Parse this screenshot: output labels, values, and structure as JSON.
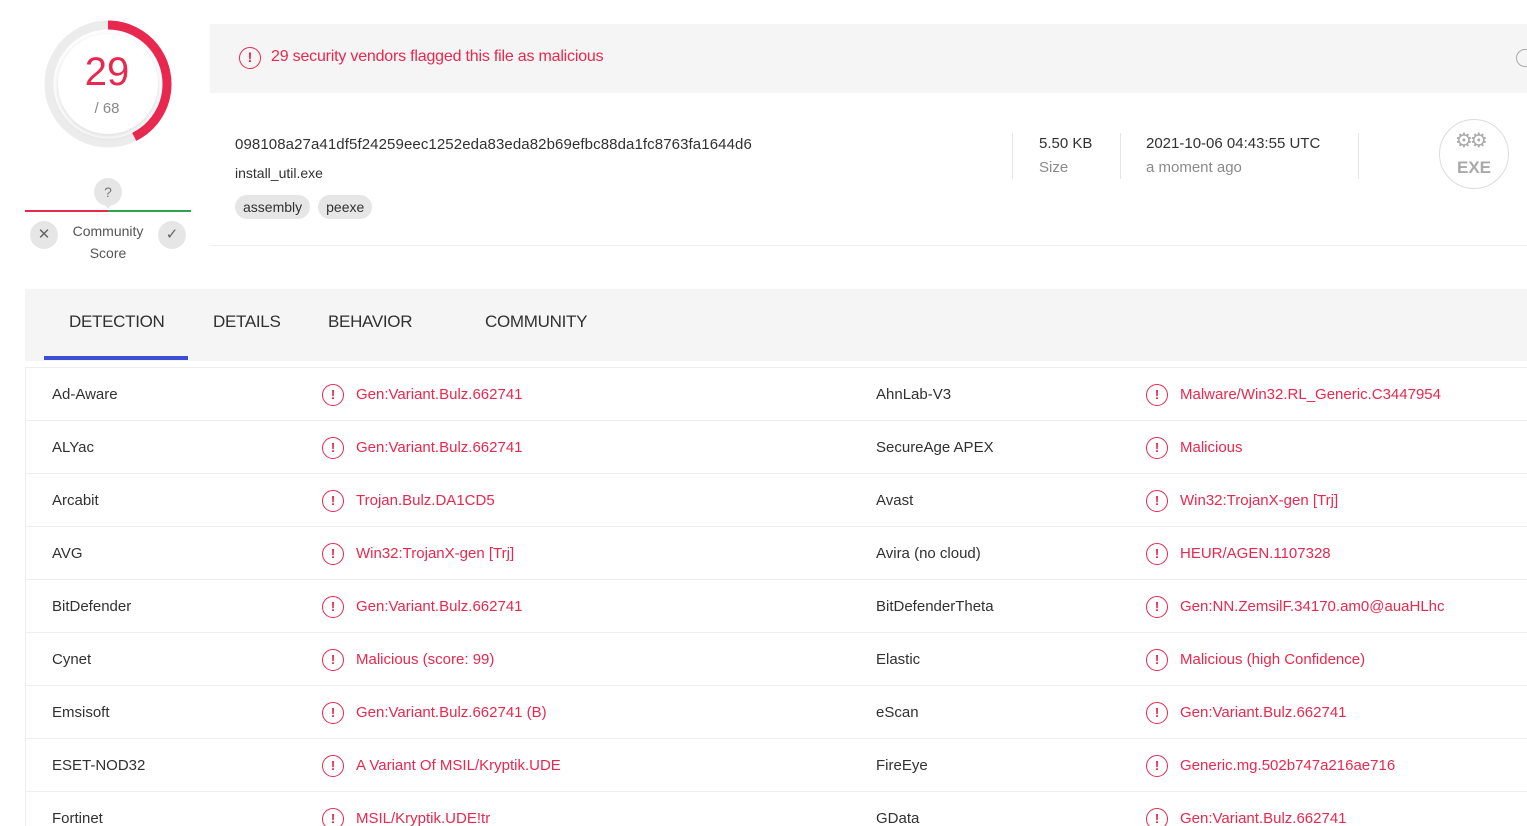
{
  "score": {
    "detections": "29",
    "total": "/ 68",
    "ratio": 0.4265
  },
  "community": {
    "question": "?",
    "label": "Community Score",
    "vote_down": "✕",
    "vote_up": "✓"
  },
  "alert": {
    "text": "29 security vendors flagged this file as malicious",
    "icon": "!"
  },
  "file": {
    "hash": "098108a27a41df5f24259eec1252eda83eda82b69efbc88da1fc8763fa1644d6",
    "name": "install_util.exe",
    "tags": [
      "assembly",
      "peexe"
    ],
    "size_value": "5.50 KB",
    "size_label": "Size",
    "date_value": "2021-10-06 04:43:55 UTC",
    "date_label": "a moment ago",
    "type_icon": "EXE"
  },
  "tabs": [
    "DETECTION",
    "DETAILS",
    "BEHAVIOR",
    "COMMUNITY"
  ],
  "colors": {
    "malicious": "#e8284e",
    "accent": "#3a4fd6",
    "clean": "#2ba44f"
  },
  "detections": [
    [
      {
        "engine": "Ad-Aware",
        "result": "Gen:Variant.Bulz.662741"
      },
      {
        "engine": "AhnLab-V3",
        "result": "Malware/Win32.RL_Generic.C3447954"
      }
    ],
    [
      {
        "engine": "ALYac",
        "result": "Gen:Variant.Bulz.662741"
      },
      {
        "engine": "SecureAge APEX",
        "result": "Malicious"
      }
    ],
    [
      {
        "engine": "Arcabit",
        "result": "Trojan.Bulz.DA1CD5"
      },
      {
        "engine": "Avast",
        "result": "Win32:TrojanX-gen [Trj]"
      }
    ],
    [
      {
        "engine": "AVG",
        "result": "Win32:TrojanX-gen [Trj]"
      },
      {
        "engine": "Avira (no cloud)",
        "result": "HEUR/AGEN.1107328"
      }
    ],
    [
      {
        "engine": "BitDefender",
        "result": "Gen:Variant.Bulz.662741"
      },
      {
        "engine": "BitDefenderTheta",
        "result": "Gen:NN.ZemsilF.34170.am0@auaHLhc"
      }
    ],
    [
      {
        "engine": "Cynet",
        "result": "Malicious (score: 99)"
      },
      {
        "engine": "Elastic",
        "result": "Malicious (high Confidence)"
      }
    ],
    [
      {
        "engine": "Emsisoft",
        "result": "Gen:Variant.Bulz.662741 (B)"
      },
      {
        "engine": "eScan",
        "result": "Gen:Variant.Bulz.662741"
      }
    ],
    [
      {
        "engine": "ESET-NOD32",
        "result": "A Variant Of MSIL/Kryptik.UDE"
      },
      {
        "engine": "FireEye",
        "result": "Generic.mg.502b747a216ae716"
      }
    ],
    [
      {
        "engine": "Fortinet",
        "result": "MSIL/Kryptik.UDE!tr"
      },
      {
        "engine": "GData",
        "result": "Gen:Variant.Bulz.662741"
      }
    ]
  ]
}
